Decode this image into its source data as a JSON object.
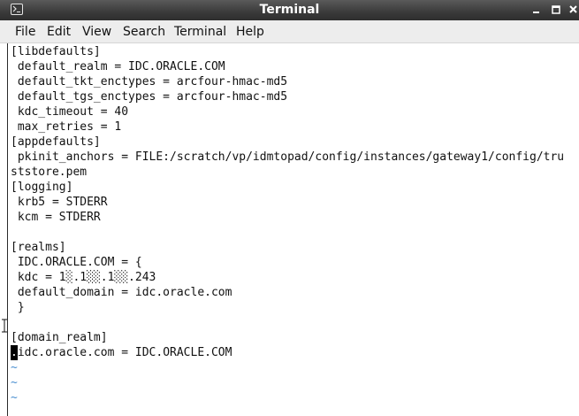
{
  "window": {
    "title": "Terminal"
  },
  "menu": [
    "File",
    "Edit",
    "View",
    "Search",
    "Terminal",
    "Help"
  ],
  "terminal": {
    "lines": [
      "[libdefaults]",
      " default_realm = IDC.ORACLE.COM",
      " default_tkt_enctypes = arcfour-hmac-md5",
      " default_tgs_enctypes = arcfour-hmac-md5",
      " kdc_timeout = 40",
      " max_retries = 1",
      "[appdefaults]",
      " pkinit_anchors = FILE:/scratch/vp/idmtopad/config/instances/gateway1/config/tru",
      "ststore.pem",
      "[logging]",
      " krb5 = STDERR",
      " kcm = STDERR",
      "",
      "[realms]",
      " IDC.ORACLE.COM = {",
      " kdc = 1░.1░░.1░░.243",
      " default_domain = idc.oracle.com",
      " }",
      "",
      "[domain_realm]",
      "idc.oracle.com = IDC.ORACLE.COM"
    ],
    "cursor_char": ".",
    "tildes": [
      "~",
      "~",
      "~"
    ]
  },
  "icons": {
    "title": "terminal-icon",
    "minimize": "minimize-icon",
    "maximize": "maximize-icon",
    "close": "close-icon",
    "pointer": "text-cursor-icon"
  },
  "colors": {
    "titlebar": "#3a3a3a",
    "menubar": "#ededed",
    "terminal_bg": "#ffffff",
    "terminal_fg": "#111111",
    "tilde": "#4a8fd0"
  }
}
